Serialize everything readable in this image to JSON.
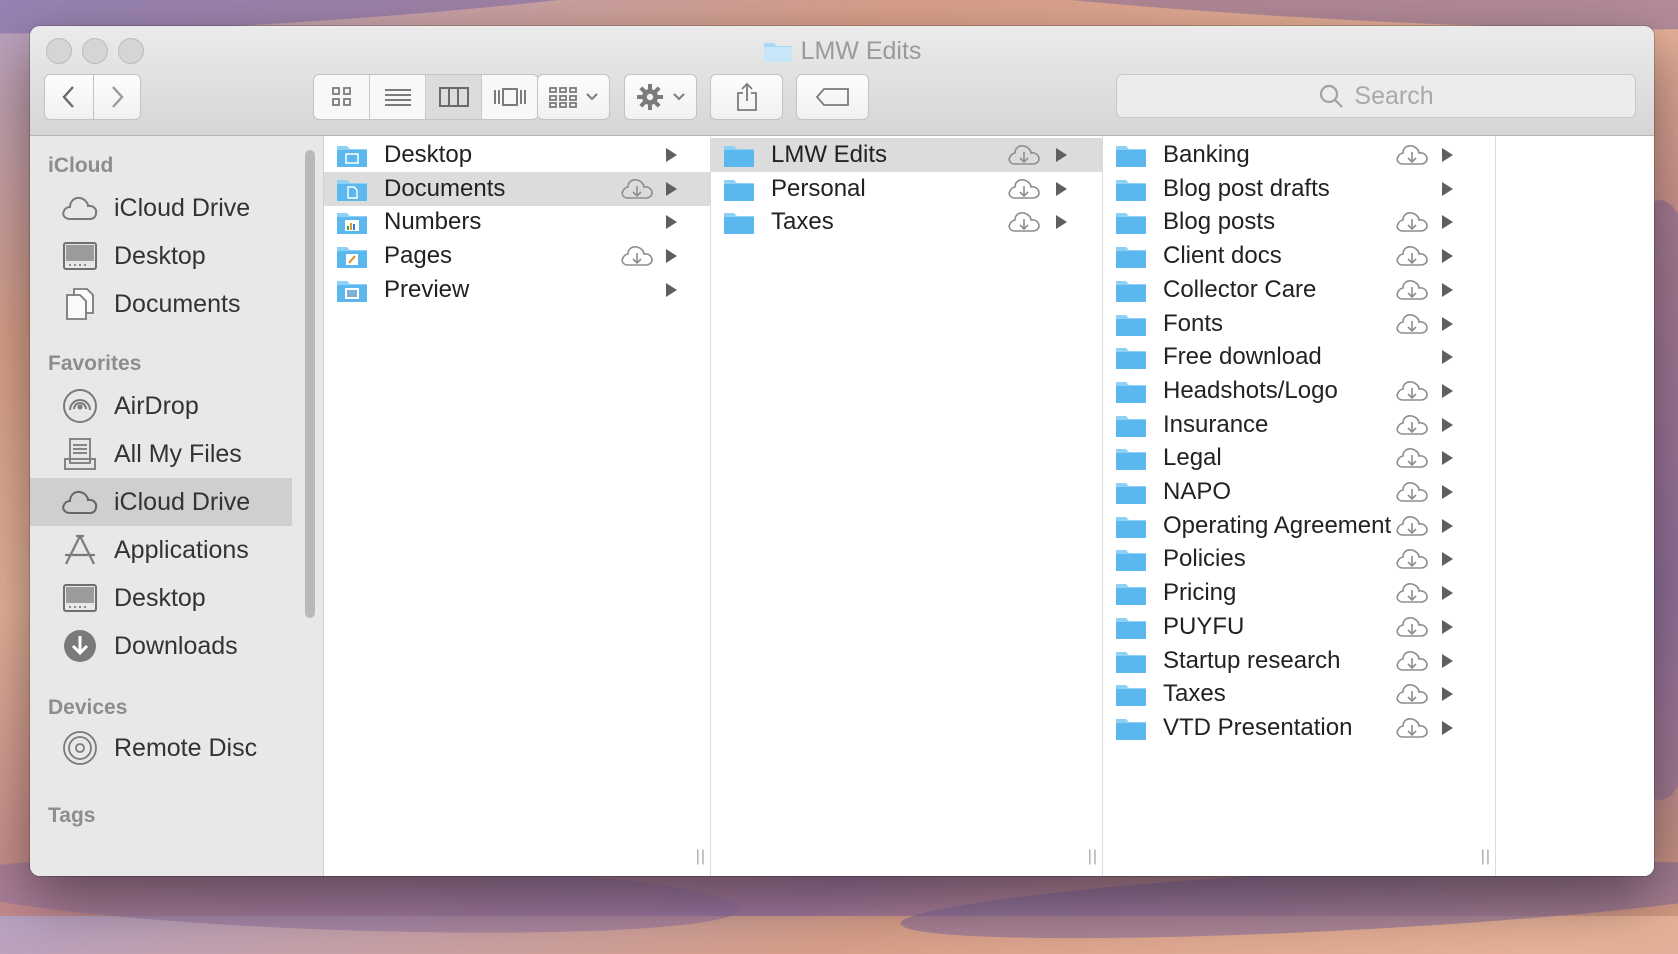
{
  "window": {
    "title": "LMW Edits"
  },
  "toolbar": {
    "back_icon": "chevron-left-icon",
    "forward_icon": "chevron-right-icon",
    "view_modes": [
      "icon-view-icon",
      "list-view-icon",
      "column-view-icon",
      "cover-flow-icon"
    ],
    "active_view": "column-view-icon",
    "arrange_icon": "arrange-grid-icon",
    "action_icon": "gear-icon",
    "share_icon": "share-icon",
    "tag_icon": "tag-icon",
    "search": {
      "placeholder": "Search"
    }
  },
  "sidebar": {
    "sections": [
      {
        "heading": "iCloud",
        "items": [
          {
            "label": "iCloud Drive",
            "icon": "cloud-icon"
          },
          {
            "label": "Desktop",
            "icon": "desktop-icon"
          },
          {
            "label": "Documents",
            "icon": "documents-icon"
          }
        ]
      },
      {
        "heading": "Favorites",
        "items": [
          {
            "label": "AirDrop",
            "icon": "airdrop-icon"
          },
          {
            "label": "All My Files",
            "icon": "all-files-icon"
          },
          {
            "label": "iCloud Drive",
            "icon": "cloud-icon",
            "selected": true
          },
          {
            "label": "Applications",
            "icon": "applications-icon"
          },
          {
            "label": "Desktop",
            "icon": "desktop-icon"
          },
          {
            "label": "Downloads",
            "icon": "downloads-icon"
          }
        ]
      },
      {
        "heading": "Devices",
        "items": [
          {
            "label": "Remote Disc",
            "icon": "disc-icon"
          }
        ]
      },
      {
        "heading": "Tags",
        "items": []
      }
    ]
  },
  "columns": [
    {
      "items": [
        {
          "name": "Desktop",
          "icon": "desktop-folder-icon",
          "cloud": false,
          "has_children": true
        },
        {
          "name": "Documents",
          "icon": "documents-folder-icon",
          "cloud": true,
          "has_children": true,
          "selected": true
        },
        {
          "name": "Numbers",
          "icon": "numbers-folder-icon",
          "cloud": false,
          "has_children": true
        },
        {
          "name": "Pages",
          "icon": "pages-folder-icon",
          "cloud": true,
          "has_children": true
        },
        {
          "name": "Preview",
          "icon": "preview-folder-icon",
          "cloud": false,
          "has_children": true
        }
      ]
    },
    {
      "items": [
        {
          "name": "LMW Edits",
          "icon": "folder-icon",
          "cloud": true,
          "has_children": true,
          "selected": true
        },
        {
          "name": "Personal",
          "icon": "folder-icon",
          "cloud": true,
          "has_children": true
        },
        {
          "name": "Taxes",
          "icon": "folder-icon",
          "cloud": true,
          "has_children": true
        }
      ]
    },
    {
      "items": [
        {
          "name": "Banking",
          "icon": "folder-icon",
          "cloud": true,
          "has_children": true
        },
        {
          "name": "Blog post drafts",
          "icon": "folder-icon",
          "cloud": false,
          "has_children": true
        },
        {
          "name": "Blog posts",
          "icon": "folder-icon",
          "cloud": true,
          "has_children": true
        },
        {
          "name": "Client docs",
          "icon": "folder-icon",
          "cloud": true,
          "has_children": true
        },
        {
          "name": "Collector Care",
          "icon": "folder-icon",
          "cloud": true,
          "has_children": true
        },
        {
          "name": "Fonts",
          "icon": "folder-icon",
          "cloud": true,
          "has_children": true
        },
        {
          "name": "Free download",
          "icon": "folder-icon",
          "cloud": false,
          "has_children": true
        },
        {
          "name": "Headshots/Logo",
          "icon": "folder-icon",
          "cloud": true,
          "has_children": true
        },
        {
          "name": "Insurance",
          "icon": "folder-icon",
          "cloud": true,
          "has_children": true
        },
        {
          "name": "Legal",
          "icon": "folder-icon",
          "cloud": true,
          "has_children": true
        },
        {
          "name": "NAPO",
          "icon": "folder-icon",
          "cloud": true,
          "has_children": true
        },
        {
          "name": "Operating Agreement",
          "icon": "folder-icon",
          "cloud": true,
          "has_children": true
        },
        {
          "name": "Policies",
          "icon": "folder-icon",
          "cloud": true,
          "has_children": true
        },
        {
          "name": "Pricing",
          "icon": "folder-icon",
          "cloud": true,
          "has_children": true
        },
        {
          "name": "PUYFU",
          "icon": "folder-icon",
          "cloud": true,
          "has_children": true
        },
        {
          "name": "Startup research",
          "icon": "folder-icon",
          "cloud": true,
          "has_children": true
        },
        {
          "name": "Taxes",
          "icon": "folder-icon",
          "cloud": true,
          "has_children": true
        },
        {
          "name": "VTD Presentation",
          "icon": "folder-icon",
          "cloud": true,
          "has_children": true
        }
      ]
    }
  ],
  "colors": {
    "folder": "#5ab8ef",
    "folder_tab": "#8fd0f6",
    "selection": "#dcdcdc",
    "sidebar_bg": "#e8e8e8",
    "sidebar_selection": "#cfcfcf"
  }
}
